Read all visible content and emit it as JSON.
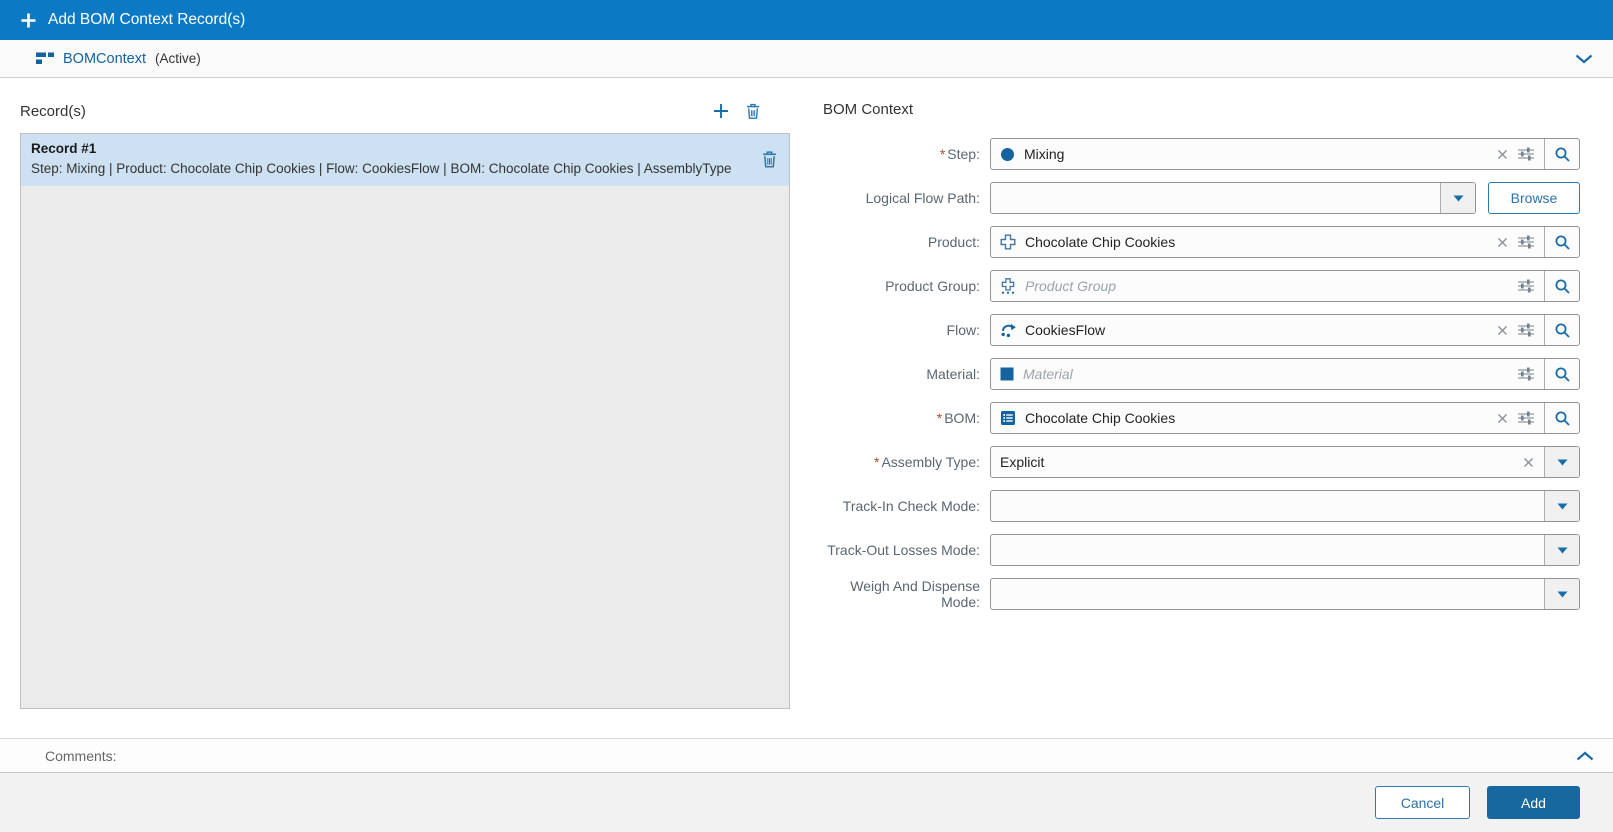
{
  "titlebar": {
    "title": "Add BOM Context Record(s)"
  },
  "entity_bar": {
    "name": "BOMContext",
    "status": "(Active)"
  },
  "records_panel": {
    "title": "Record(s)",
    "records": [
      {
        "name": "Record #1",
        "details": "Step: Mixing | Product: Chocolate Chip Cookies | Flow: CookiesFlow | BOM: Chocolate Chip Cookies | AssemblyType"
      }
    ]
  },
  "form": {
    "title": "BOM Context",
    "required_marker": "*",
    "fields": {
      "step": {
        "label": "Step:",
        "value": "Mixing",
        "required": true
      },
      "logical_flow_path": {
        "label": "Logical Flow Path:",
        "value": "",
        "browse_label": "Browse"
      },
      "product": {
        "label": "Product:",
        "value": "Chocolate Chip Cookies"
      },
      "product_group": {
        "label": "Product Group:",
        "value": "",
        "placeholder": "Product Group"
      },
      "flow": {
        "label": "Flow:",
        "value": "CookiesFlow"
      },
      "material": {
        "label": "Material:",
        "value": "",
        "placeholder": "Material"
      },
      "bom": {
        "label": "BOM:",
        "value": "Chocolate Chip Cookies",
        "required": true
      },
      "assembly_type": {
        "label": "Assembly Type:",
        "value": "Explicit",
        "required": true
      },
      "track_in_check_mode": {
        "label": "Track-In Check Mode:",
        "value": ""
      },
      "track_out_losses_mode": {
        "label": "Track-Out Losses Mode:",
        "value": ""
      },
      "weigh_and_dispense_mode": {
        "label": "Weigh And Dispense Mode:",
        "value": ""
      }
    }
  },
  "comments": {
    "label": "Comments:"
  },
  "footer": {
    "cancel_label": "Cancel",
    "add_label": "Add"
  },
  "colors": {
    "header_blue": "#0b79c3",
    "accent_blue": "#1a6ca8",
    "icon_blue": "#15639e",
    "selected_row_blue": "#cee1f2",
    "add_button_blue": "#16689e",
    "required_star": "#a5502d"
  }
}
